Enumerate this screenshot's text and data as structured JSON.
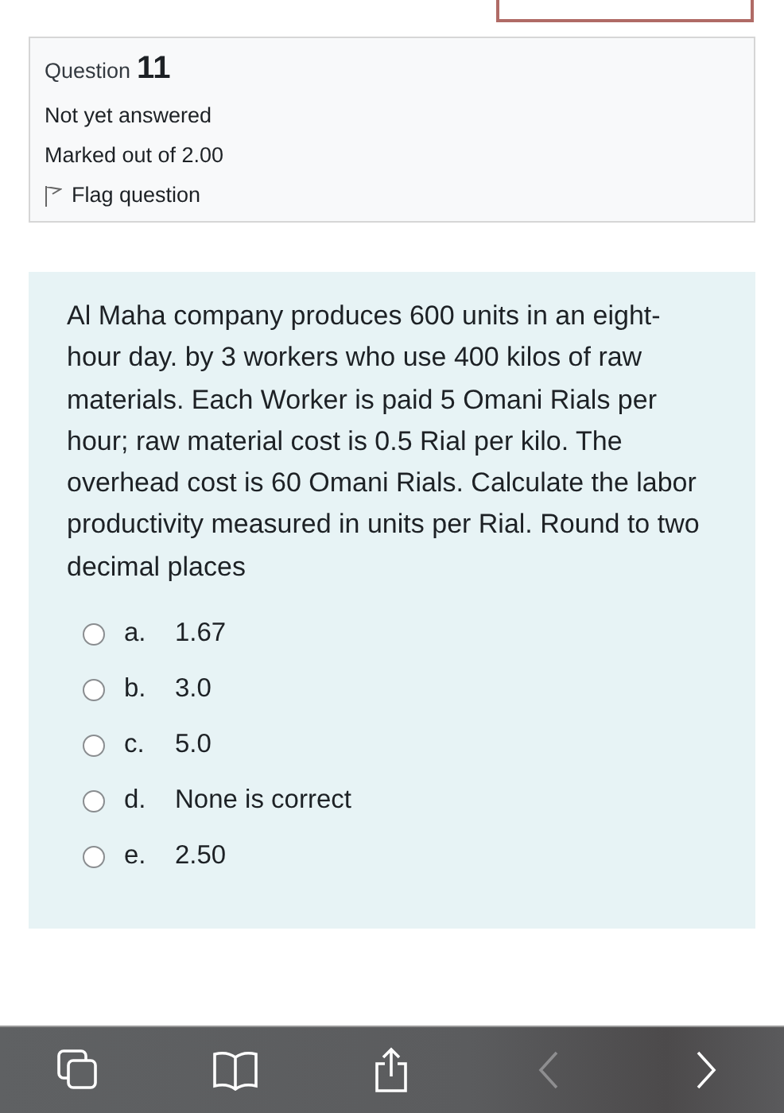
{
  "info": {
    "question_label": "Question",
    "question_number": "11",
    "status": "Not yet answered",
    "marks": "Marked out of 2.00",
    "flag": "Flag question"
  },
  "question": {
    "text": "Al Maha company produces 600 units in an eight-hour day. by 3 workers who use 400 kilos of raw materials. Each Worker is paid 5 Omani Rials per hour; raw material cost is 0.5 Rial per kilo. The overhead cost is 60 Omani Rials. Calculate the labor productivity measured in units per Rial. Round to two decimal places",
    "options": [
      {
        "letter": "a.",
        "text": "1.67",
        "selected": false
      },
      {
        "letter": "b.",
        "text": "3.0",
        "selected": false
      },
      {
        "letter": "c.",
        "text": "5.0",
        "selected": false
      },
      {
        "letter": "d.",
        "text": "None is correct",
        "selected": false
      },
      {
        "letter": "e.",
        "text": "2.50",
        "selected": false
      }
    ]
  },
  "toolbar": [
    {
      "kind": "tabs",
      "disabled": false
    },
    {
      "kind": "bookmarks",
      "disabled": false
    },
    {
      "kind": "share",
      "disabled": false
    },
    {
      "kind": "back",
      "disabled": true
    },
    {
      "kind": "forward",
      "disabled": false
    }
  ]
}
